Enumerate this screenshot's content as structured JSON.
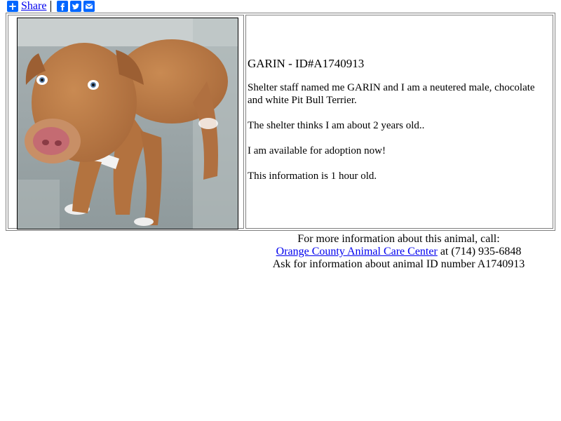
{
  "share": {
    "label": "Share",
    "icons": [
      "plus-icon",
      "facebook-icon",
      "twitter-icon",
      "email-icon"
    ],
    "color": "#0166ff"
  },
  "pet": {
    "title": "GARIN - ID#A1740913",
    "paragraphs": [
      "Shelter staff named me GARIN and I am a neutered male, chocolate and white Pit Bull Terrier.",
      "The shelter thinks I am about 2 years old..",
      "I am available for adoption now!",
      "This information is 1 hour old."
    ]
  },
  "info": {
    "line1": "For more information about this animal, call:",
    "shelter_name": "Orange County Animal Care Center",
    "line2_suffix": " at (714) 935-6848",
    "line3": "Ask for information about animal ID number A1740913"
  },
  "colors": {
    "link": "#0000ee",
    "border": "#808080"
  }
}
